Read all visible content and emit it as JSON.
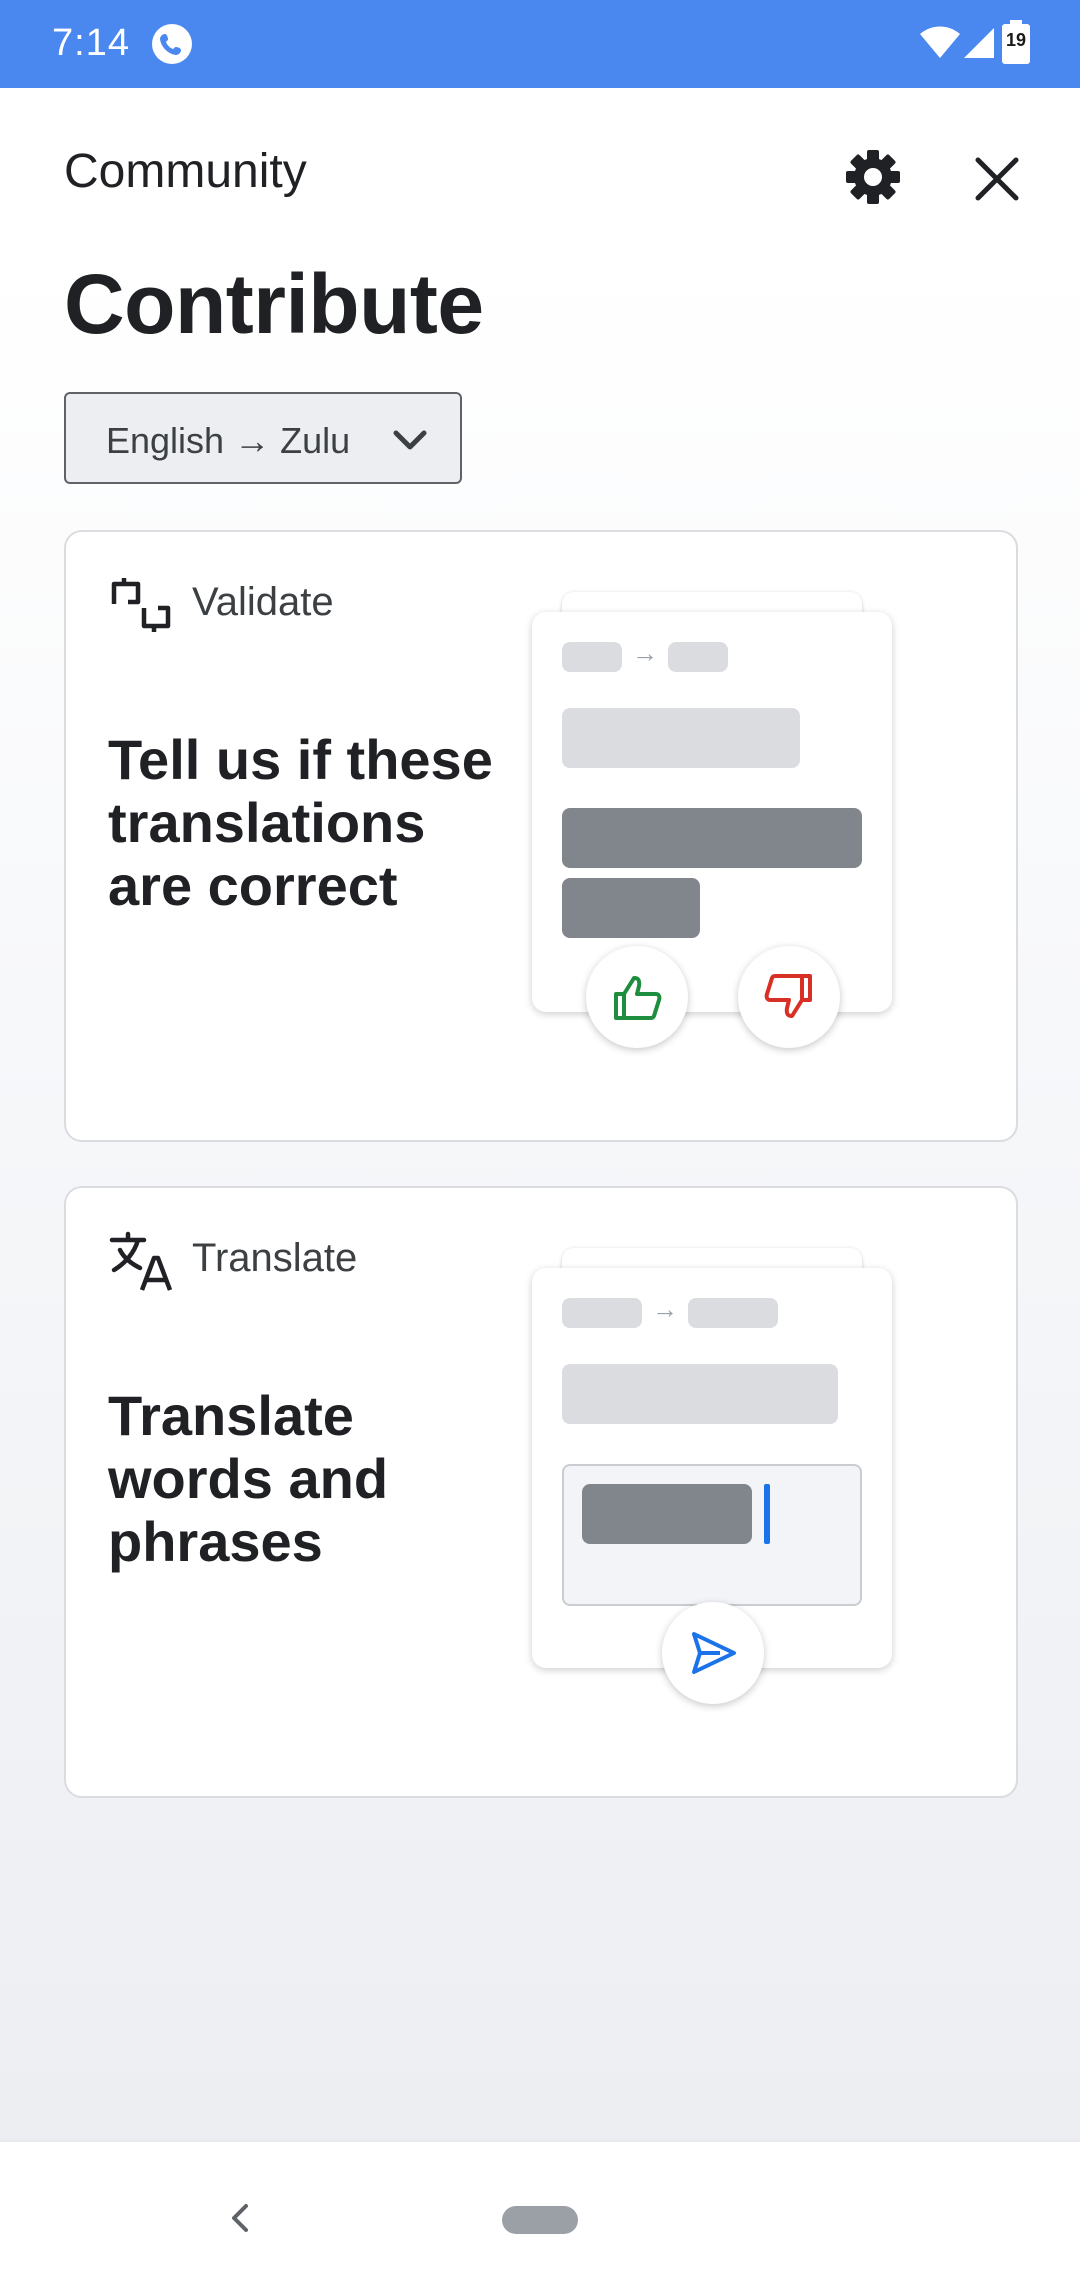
{
  "status_bar": {
    "time": "7:14",
    "battery_level": "19",
    "icons": [
      "phone-icon",
      "wifi-icon",
      "signal-icon",
      "battery-icon"
    ]
  },
  "header": {
    "title": "Community",
    "settings_icon": "gear-icon",
    "close_icon": "close-icon"
  },
  "main": {
    "heading": "Contribute",
    "language_selector": {
      "value": "English → Zulu",
      "icon": "chevron-down-icon"
    },
    "cards": [
      {
        "label": "Validate",
        "icon": "validate-thumbs-icon",
        "text": "Tell us if these translations are correct",
        "illustration_buttons": [
          "thumbs-up-icon",
          "thumbs-down-icon"
        ]
      },
      {
        "label": "Translate",
        "icon": "translate-icon",
        "text": "Translate words and phrases",
        "illustration_buttons": [
          "send-icon"
        ]
      }
    ]
  },
  "colors": {
    "status_bar": "#4a88f0",
    "accent_blue": "#1a73e8",
    "thumbs_up_green": "#1e8e3e",
    "thumbs_down_red": "#d93025",
    "placeholder_light": "#dadce0",
    "placeholder_dark": "#80868b"
  },
  "nav_bar": {
    "back_icon": "back-chevron-icon",
    "home_icon": "home-pill-icon"
  }
}
